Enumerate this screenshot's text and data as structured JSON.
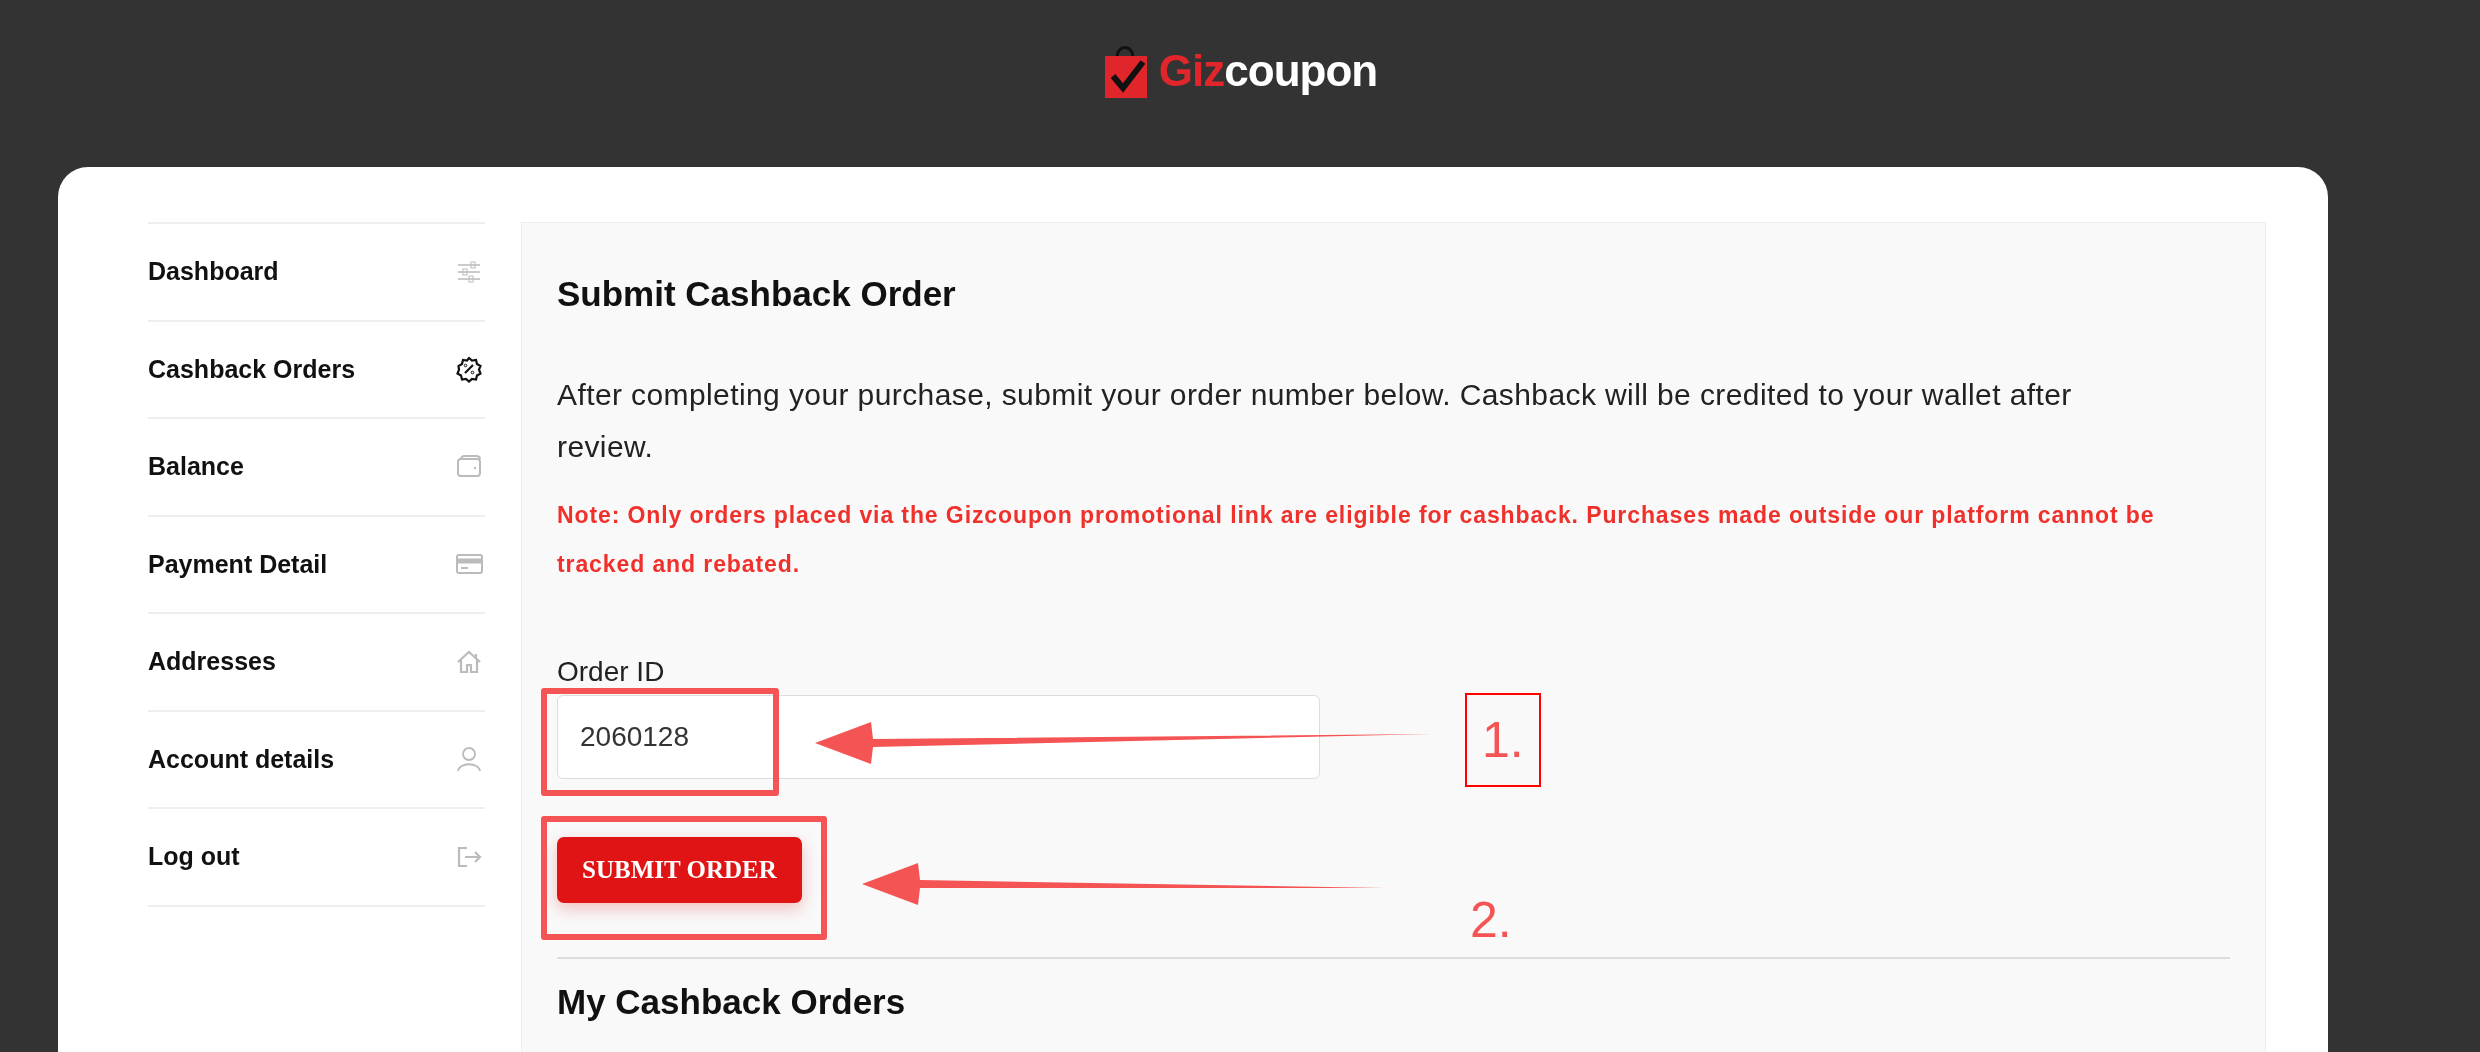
{
  "logo": {
    "brand_part": "Giz",
    "rest_part": "coupon"
  },
  "sidebar": {
    "items": [
      {
        "label": "Dashboard",
        "selected": false
      },
      {
        "label": "Cashback Orders",
        "selected": true
      },
      {
        "label": "Balance",
        "selected": false
      },
      {
        "label": "Payment Detail",
        "selected": false
      },
      {
        "label": "Addresses",
        "selected": false
      },
      {
        "label": "Account details",
        "selected": false
      },
      {
        "label": "Log out",
        "selected": false
      }
    ]
  },
  "main": {
    "title": "Submit Cashback Order",
    "intro": "After completing your purchase, submit your order number below. Cashback will be credited to your wallet after review.",
    "note": "Note: Only orders placed via the Gizcoupon promotional link are eligible for cashback. Purchases made outside our platform cannot be tracked and rebated.",
    "order_field": {
      "label": "Order ID",
      "value": "2060128"
    },
    "submit_button": "SUBMIT ORDER",
    "orders_title": "My Cashback Orders"
  },
  "annotations": [
    {
      "label": "1."
    },
    {
      "label": "2."
    }
  ]
}
